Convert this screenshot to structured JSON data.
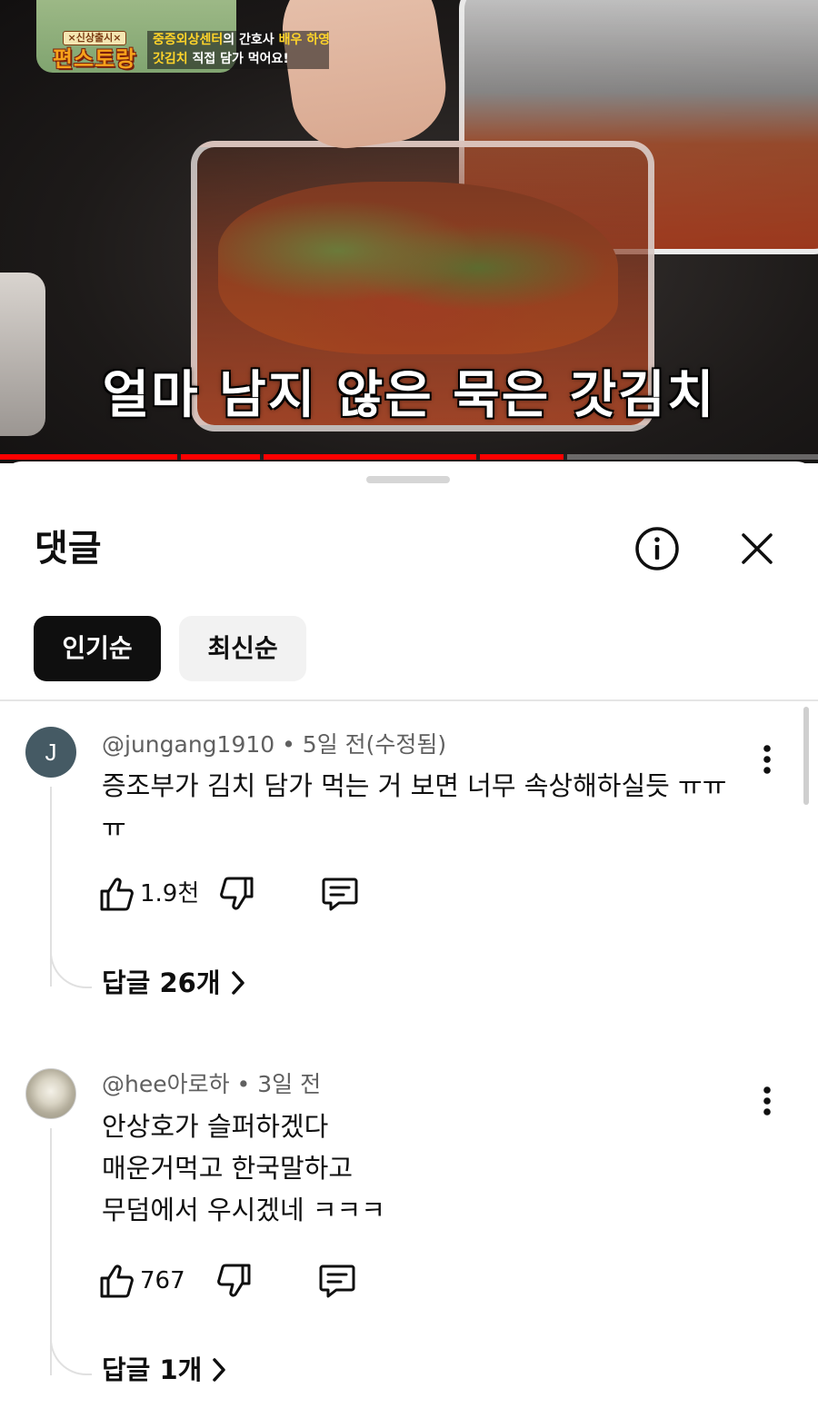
{
  "video": {
    "subtitle": "얼마 남지 않은 묵은 갓김치",
    "show_logo_top": "×신상출시×",
    "show_logo_main": "편스토랑",
    "caption_line1_part1": "중증외상센터",
    "caption_line1_part2": "의 간호사 ",
    "caption_line1_part3": "배우 하영",
    "caption_line2_part1": "갓김치",
    "caption_line2_part2": " 직접 담가 먹어요!",
    "progress_fraction": 0.69
  },
  "sheet": {
    "title": "댓글",
    "sort_chips": [
      {
        "label": "인기순",
        "selected": true
      },
      {
        "label": "최신순",
        "selected": false
      }
    ]
  },
  "comments": [
    {
      "avatar_letter": "J",
      "avatar_color": "#455a64",
      "meta": "@jungang1910 • 5일 전(수정됨)",
      "lines": [
        "증조부가 김치 담가 먹는 거 보면 너무 속상해하실듯 ㅠㅠ",
        "ㅠ"
      ],
      "likes": "1.9천",
      "replies": "답글 26개"
    },
    {
      "avatar_letter": "",
      "meta": "@hee아로하 • 3일 전",
      "lines": [
        "안상호가 슬퍼하겠다",
        "매운거먹고 한국말하고",
        "무덤에서 우시겠네 ㅋㅋㅋ"
      ],
      "likes": "767",
      "replies": "답글 1개"
    }
  ],
  "colors": {
    "accent_red": "#ff0000",
    "chip_active_bg": "#0f0f0f",
    "chip_inactive_bg": "#f2f2f2",
    "meta_gray": "#606060"
  },
  "icons": [
    "info-icon",
    "close-icon",
    "more-vert-icon",
    "thumb-up-icon",
    "thumb-down-icon",
    "reply-icon",
    "chevron-right-icon"
  ]
}
